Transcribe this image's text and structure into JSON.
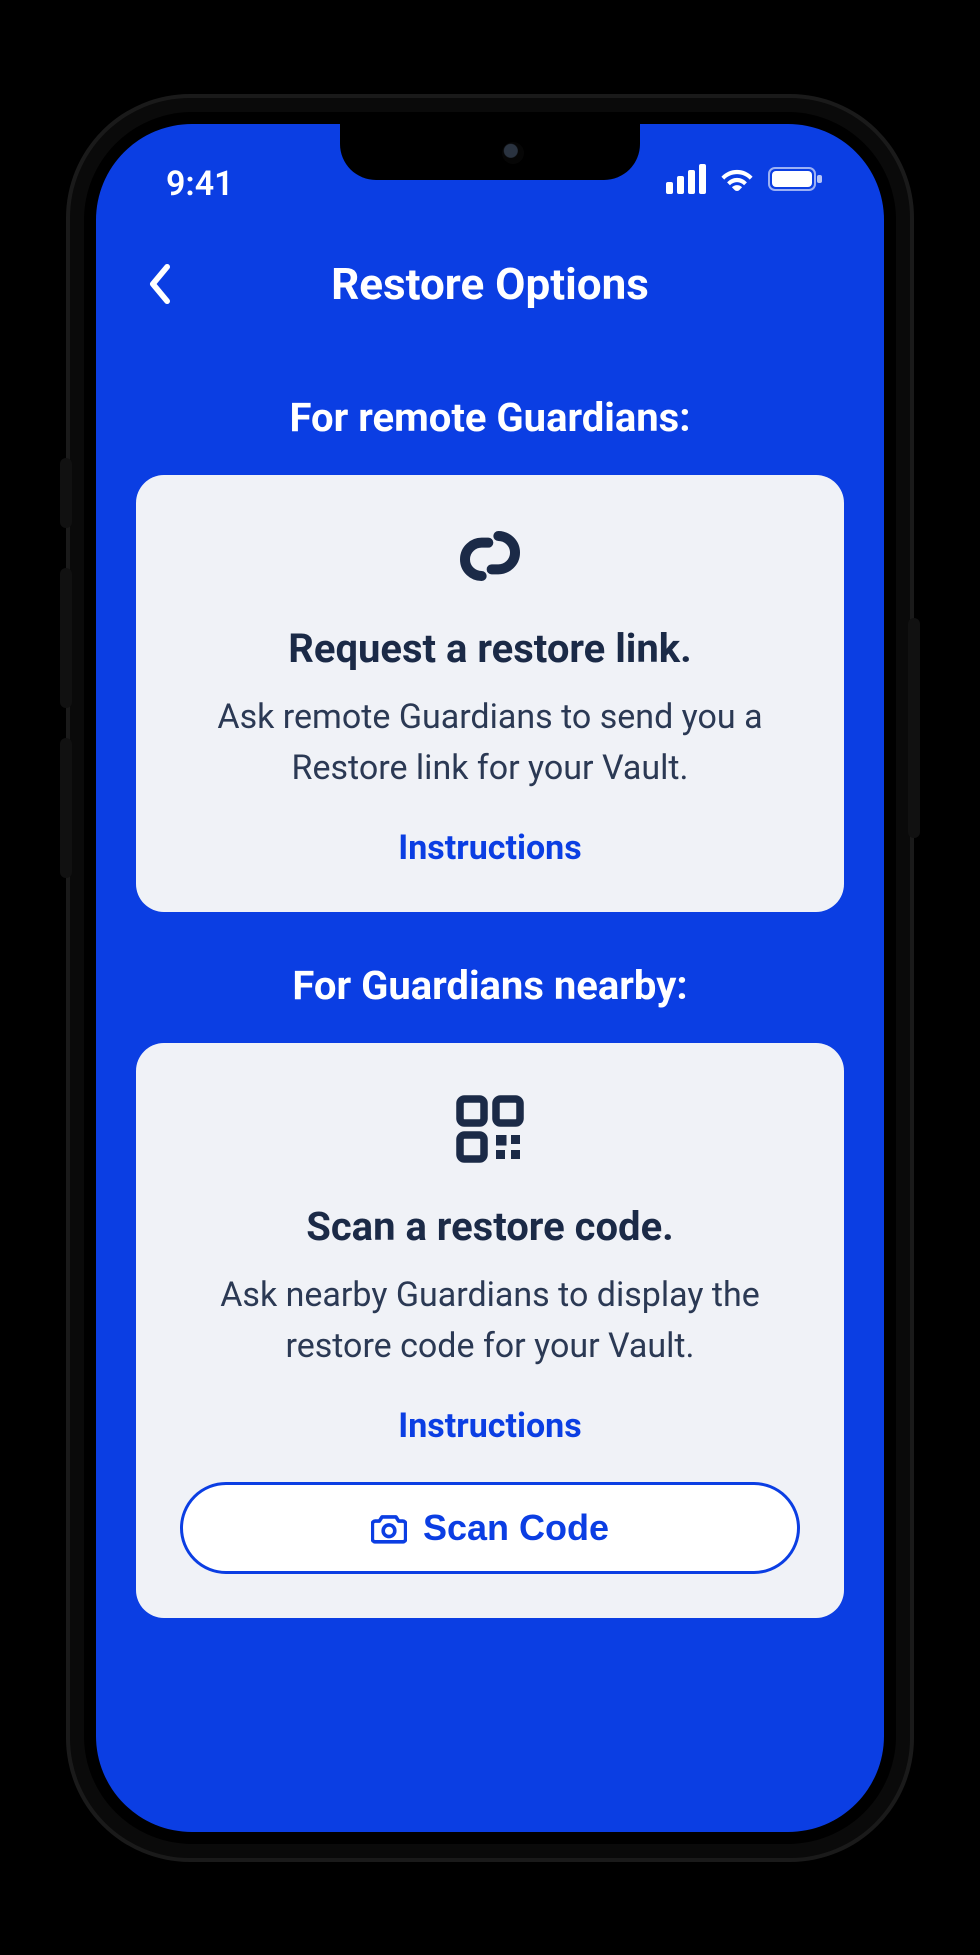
{
  "status": {
    "time": "9:41"
  },
  "nav": {
    "title": "Restore Options"
  },
  "sections": {
    "remote": {
      "label": "For remote Guardians:",
      "card": {
        "title": "Request a restore link.",
        "body": "Ask remote Guardians to send you a Restore link for your Vault.",
        "link": "Instructions"
      }
    },
    "nearby": {
      "label": "For Guardians nearby:",
      "card": {
        "title": "Scan a restore code.",
        "body": "Ask nearby Guardians to display the restore code for your Vault.",
        "link": "Instructions",
        "button": "Scan Code"
      }
    }
  },
  "colors": {
    "blue": "#0b3ee3",
    "card": "#f0f2f7",
    "dark": "#1b2a47",
    "white": "#ffffff"
  }
}
